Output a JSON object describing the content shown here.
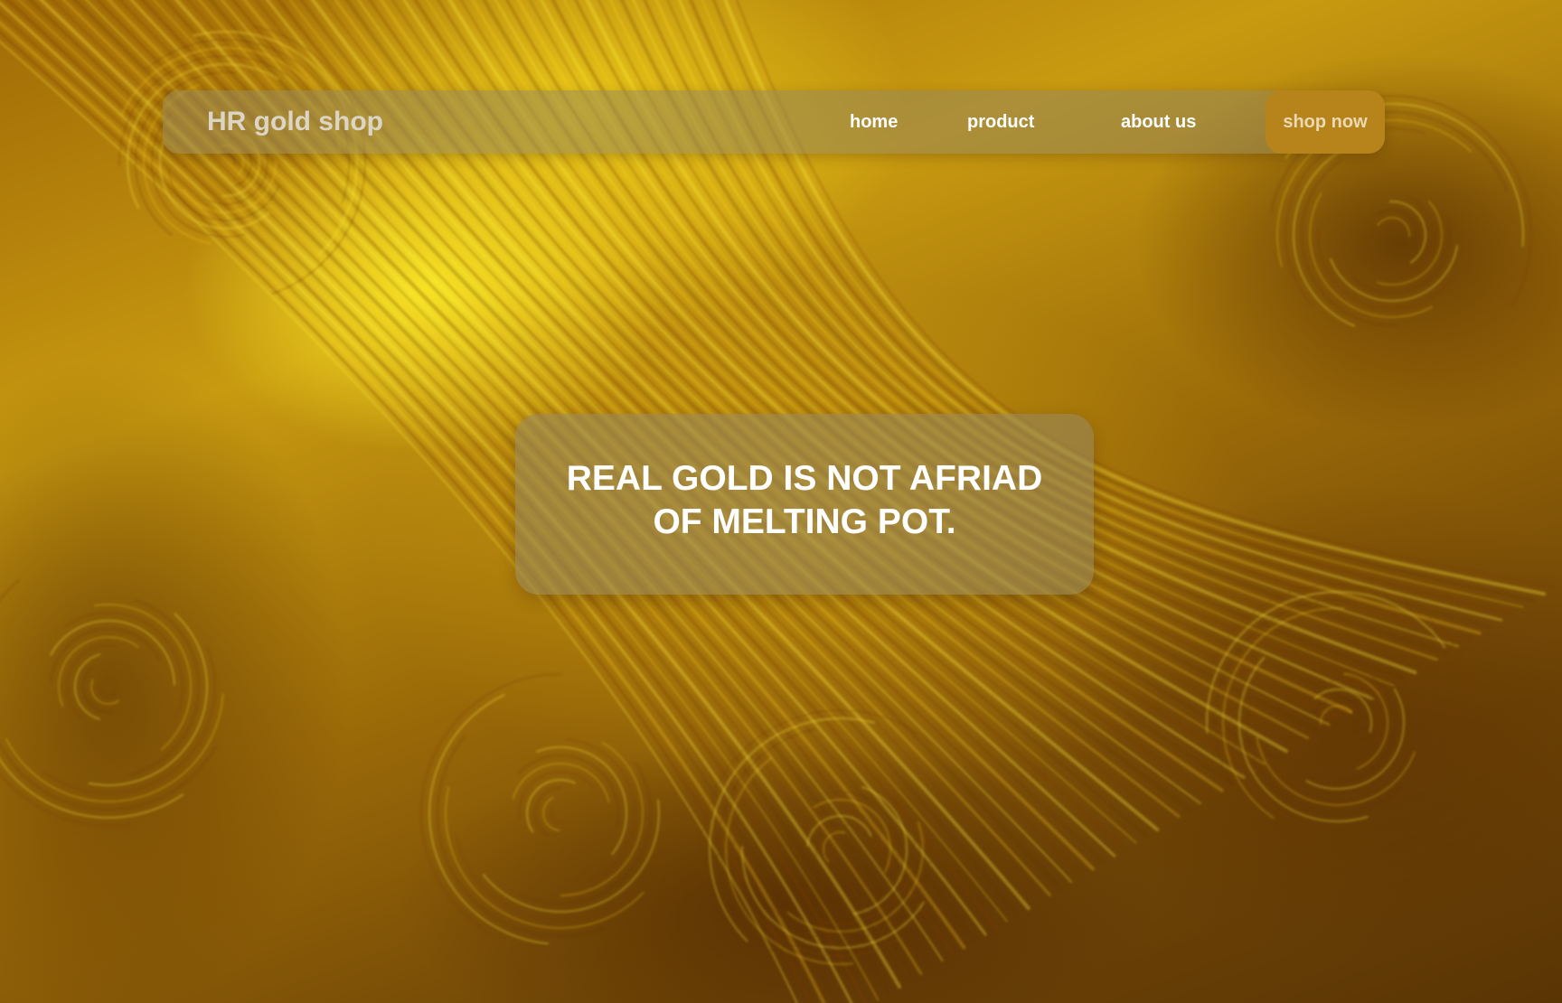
{
  "header": {
    "brand": "HR gold shop",
    "nav_items": [
      {
        "label": "home"
      },
      {
        "label": "product"
      },
      {
        "label": "about us"
      }
    ],
    "cta_label": "shop now"
  },
  "hero": {
    "headline": "REAL GOLD IS NOT AFRIAD OF MELTING POT."
  },
  "colors": {
    "background_accent": "#c89a10",
    "panel_overlay": "#968759",
    "cta_background": "#b7841c",
    "brand_text": "#ddd5c4",
    "nav_text": "#ffffff"
  }
}
